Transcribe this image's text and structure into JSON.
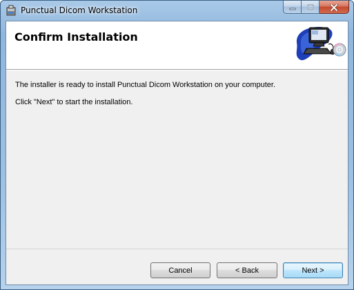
{
  "window": {
    "title": "Punctual Dicom Workstation",
    "icons": {
      "app": "installer-package-icon",
      "minimize": "minimize-icon",
      "maximize": "maximize-icon",
      "close": "close-icon",
      "banner": "computer-cd-icon"
    }
  },
  "page": {
    "title": "Confirm Installation",
    "message_line1": "The installer is ready to install Punctual Dicom Workstation on your computer.",
    "message_line2": "Click \"Next\" to start the installation."
  },
  "buttons": {
    "cancel": "Cancel",
    "back": "< Back",
    "next": "Next >"
  },
  "colors": {
    "accent_default_button": "#3c7fb1",
    "close_button": "#c34a2f",
    "panel_background": "#f0f0f0"
  }
}
